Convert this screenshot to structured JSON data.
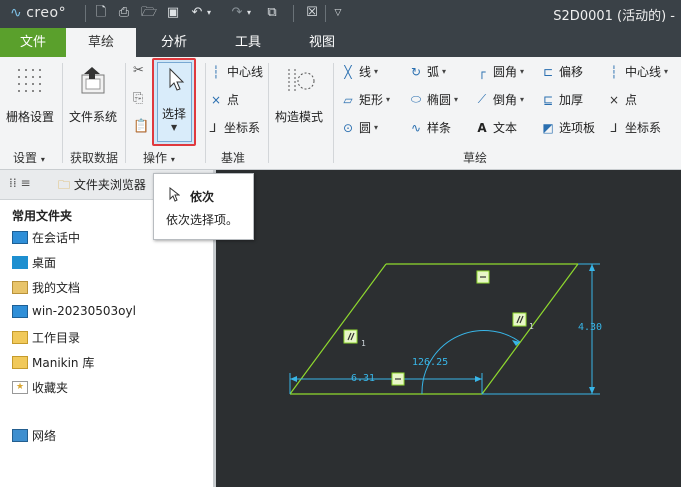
{
  "titlebar": {
    "logo": "creo",
    "title": "S2D0001 (活动的) -"
  },
  "menu": {
    "tabs": [
      "文件",
      "草绘",
      "分析",
      "工具",
      "视图"
    ]
  },
  "ribbon": {
    "settings_group": {
      "grid_label": "栅格设置",
      "group_label": "设置"
    },
    "getdata_group": {
      "filesystem_label": "文件系统",
      "group_label": "获取数据"
    },
    "operations_group": {
      "select_label": "选择",
      "group_label": "操作"
    },
    "datum_group": {
      "centerline": "中心线",
      "point": "点",
      "csys": "坐标系",
      "group_label": "基准"
    },
    "construction": {
      "label": "构造模式"
    },
    "sketch_group": {
      "line": "线",
      "rectangle": "矩形",
      "circle": "圆",
      "arc": "弧",
      "ellipse": "椭圆",
      "spline": "样条",
      "fillet": "圆角",
      "chamfer": "倒角",
      "text": "文本",
      "offset": "偏移",
      "thicken": "加厚",
      "palette": "选项板",
      "centerline": "中心线",
      "point": "点",
      "csys": "坐标系",
      "group_label": "草绘"
    }
  },
  "left_panel": {
    "tabs": [
      "文件夹浏览器"
    ],
    "section_title": "常用文件夹",
    "items": [
      "在会话中",
      "桌面",
      "我的文档",
      "win-20230503oyl",
      "工作目录",
      "Manikin 库",
      "收藏夹"
    ],
    "network": "网络"
  },
  "tooltip": {
    "title": "依次",
    "description": "依次选择项。"
  },
  "sketch": {
    "dim_length": "6.31",
    "dim_angle": "126.25",
    "dim_height": "4.30"
  },
  "colors": {
    "file_tab": "#5aa02c",
    "sketch_line": "#8fd92e",
    "dimension": "#38b6e8",
    "select_outline": "#e0393e"
  }
}
